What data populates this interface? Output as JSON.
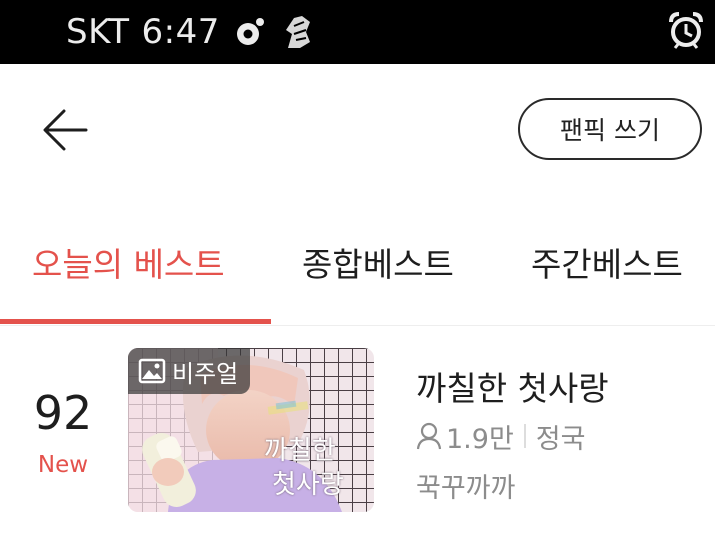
{
  "status_bar": {
    "carrier": "SKT",
    "time": "6:47",
    "icons": [
      "notification-ring-icon",
      "game-char-icon",
      "alarm-clock-icon"
    ]
  },
  "header": {
    "back_icon": "arrow-left-icon",
    "write_button_label": "팬픽 쓰기"
  },
  "tabs": [
    {
      "label": "오늘의 베스트",
      "active": true
    },
    {
      "label": "종합베스트",
      "active": false
    },
    {
      "label": "주간베스트",
      "active": false
    }
  ],
  "list": [
    {
      "rank": "92",
      "badge": "New",
      "thumbnail_badge": "비주얼",
      "thumbnail_overlay_text": [
        "까칠한",
        "첫사랑"
      ],
      "title": "까칠한 첫사랑",
      "views": "1.9만",
      "tag": "정국",
      "author": "꾹꾸까까"
    }
  ],
  "colors": {
    "accent": "#e4524c",
    "text": "#1e1e1e",
    "subtext": "#8c8c8c",
    "status_bar": "#000000"
  }
}
